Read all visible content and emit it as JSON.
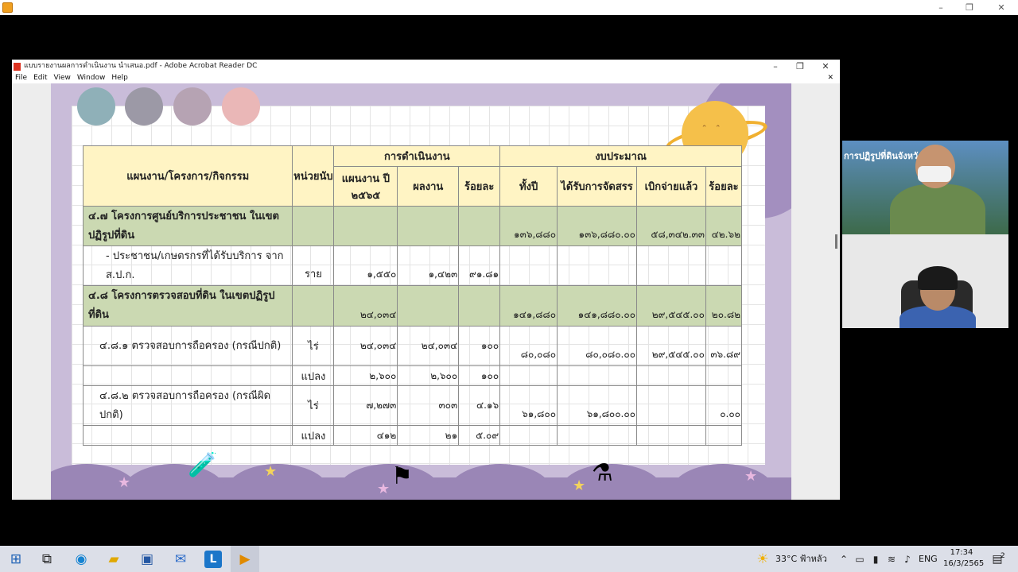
{
  "acrobat": {
    "title": "แบบรายงานผลการดำเนินงาน นำเสนอ.pdf - Adobe Acrobat Reader DC",
    "menu": [
      "File",
      "Edit",
      "View",
      "Window",
      "Help"
    ]
  },
  "table": {
    "header": {
      "col_name": "แผนงาน/โครงการ/กิจกรรม",
      "col_unit": "หน่วยนับ",
      "group_ops": "การดำเนินงาน",
      "group_budget": "งบประมาณ",
      "plan": "แผนงาน ปี ๒๕๖๕",
      "result": "ผลงาน",
      "percent": "ร้อยละ",
      "whole_year": "ทั้งปี",
      "allocated": "ได้รับการจัดสรร",
      "disbursed": "เบิกจ่ายแล้ว",
      "percent2": "ร้อยละ"
    },
    "rows": [
      {
        "name": "๔.๗ โครงการศูนย์บริการประชาชน ในเขตปฏิรูปที่ดิน",
        "unit": "",
        "plan": "",
        "result": "",
        "pct": "",
        "year": "๑๓๖,๘๘๐",
        "alloc": "๑๓๖,๘๘๐.๐๐",
        "disb": "๕๘,๓๔๒.๓๓",
        "pct2": "๔๒.๖๒",
        "type": "sec"
      },
      {
        "name": "- ประชาชน/เกษตรกรที่ได้รับบริการ จาก ส.ป.ก.",
        "unit": "ราย",
        "plan": "๑,๕๕๐",
        "result": "๑,๔๒๓",
        "pct": "๙๑.๘๑",
        "year": "",
        "alloc": "",
        "disb": "",
        "pct2": "",
        "type": "item"
      },
      {
        "name": "๔.๘ โครงการตรวจสอบที่ดิน ในเขตปฏิรูปที่ดิน",
        "unit": "",
        "plan": "๒๔,๐๓๔",
        "result": "",
        "pct": "",
        "year": "๑๔๑,๘๘๐",
        "alloc": "๑๔๑,๘๘๐.๐๐",
        "disb": "๒๙,๕๔๕.๐๐",
        "pct2": "๒๐.๘๒",
        "type": "sec"
      },
      {
        "name": "๔.๘.๑ ตรวจสอบการถือครอง (กรณีปกติ)",
        "unit": "ไร่",
        "plan": "๒๔,๐๓๔",
        "result": "๒๔,๐๓๔",
        "pct": "๑๐๐",
        "year": "๘๐,๐๘๐",
        "alloc": "๘๐,๐๘๐.๐๐",
        "disb": "๒๙,๕๔๕.๐๐",
        "pct2": "๓๖.๘๙",
        "type": "item"
      },
      {
        "name": "",
        "unit": "แปลง",
        "plan": "๒,๖๐๐",
        "result": "๒,๖๐๐",
        "pct": "๑๐๐",
        "year": "",
        "alloc": "",
        "disb": "",
        "pct2": "",
        "type": "short"
      },
      {
        "name": "๔.๘.๒ ตรวจสอบการถือครอง (กรณีผิดปกติ)",
        "unit": "ไร่",
        "plan": "๗,๒๗๓",
        "result": "๓๐๓",
        "pct": "๔.๑๖",
        "year": "๖๑,๘๐๐",
        "alloc": "๖๑,๘๐๐.๐๐",
        "disb": "",
        "pct2": "๐.๐๐",
        "type": "item"
      },
      {
        "name": "",
        "unit": "แปลง",
        "plan": "๔๑๒",
        "result": "๒๑",
        "pct": "๕.๐๙",
        "year": "",
        "alloc": "",
        "disb": "",
        "pct2": "",
        "type": "short"
      }
    ]
  },
  "webcam": {
    "banner": "การปฏิรูปที่ดินจังหวัด...นี"
  },
  "taskbar": {
    "weather": "33°C ฟ้าหลัว",
    "language": "ENG",
    "time": "17:34",
    "date": "16/3/2565",
    "notifications": "2"
  }
}
